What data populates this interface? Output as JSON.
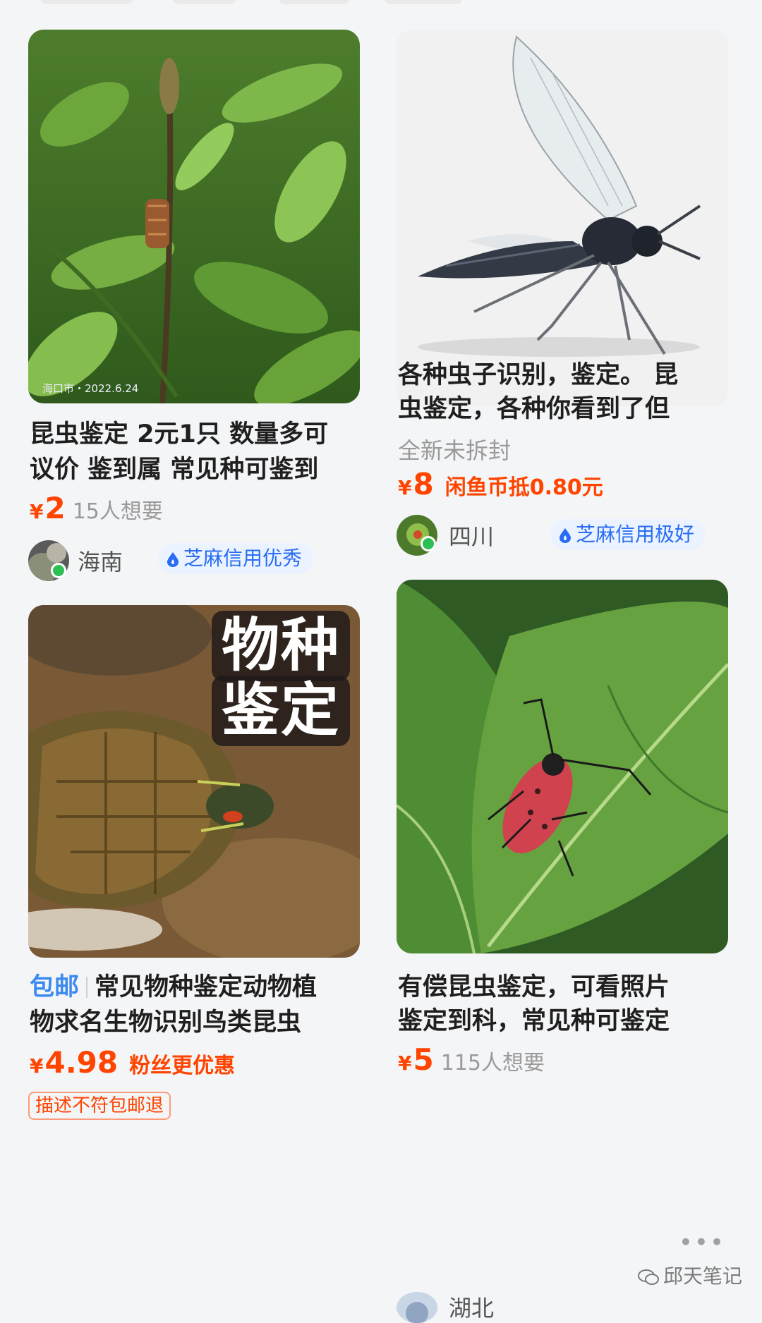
{
  "cards": [
    {
      "photo_stamp": "海口市・2022.6.24",
      "title_line1": "昆虫鉴定 2元1只 数量多可",
      "title_line2": "议价 鉴到属 常见种可鉴到",
      "currency": "¥",
      "price": "2",
      "want": "15人想要",
      "region": "海南",
      "credit": "芝麻信用优秀"
    },
    {
      "title_line1": "各种虫子识别，鉴定。 昆",
      "title_line2": "虫鉴定，各种你看到了但",
      "condition": "全新未拆封",
      "currency": "¥",
      "price": "8",
      "coin_text": "闲鱼币抵0.80元",
      "region": "四川",
      "credit": "芝麻信用极好"
    },
    {
      "overlay_line1": "物种",
      "overlay_line2": "鉴定",
      "free_shipping": "包邮",
      "title_line1": "常见物种鉴定动物植",
      "title_line2": "物求名生物识别鸟类昆虫",
      "currency": "¥",
      "price": "4.98",
      "fan_text": "粉丝更优惠",
      "return_tag": "描述不符包邮退"
    },
    {
      "title_line1": "有偿昆虫鉴定，可看照片",
      "title_line2": "鉴定到科，常见种可鉴定",
      "currency": "¥",
      "price": "5",
      "want": "115人想要",
      "region": "湖北"
    }
  ],
  "watermark": "邱天笔记",
  "more_dots": "•••",
  "colors": {
    "price": "#ff4400",
    "credit_text": "#2a6df4",
    "credit_bg": "#eaf3ff",
    "background": "#f4f5f7"
  }
}
